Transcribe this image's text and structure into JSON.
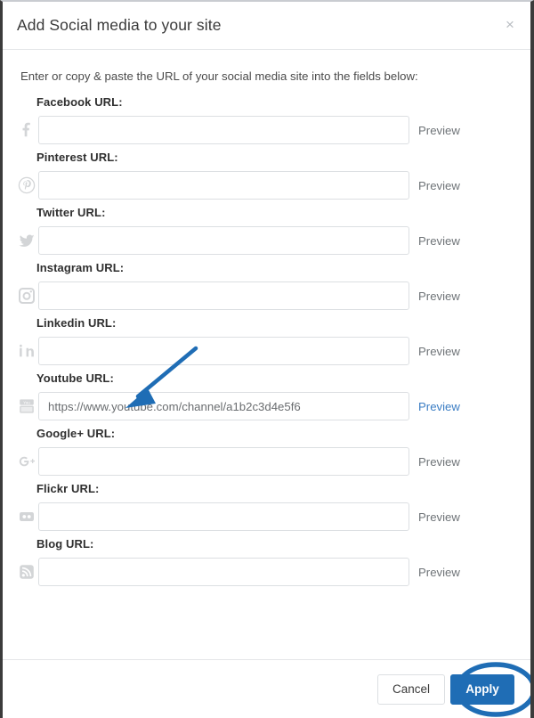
{
  "dialog": {
    "title": "Add Social media to your site",
    "close_label": "×",
    "intro": "Enter or copy & paste the URL of your social media site into the fields below:",
    "preview_label": "Preview",
    "input_placeholder": ""
  },
  "fields": [
    {
      "label": "Facebook URL:",
      "icon": "facebook-icon",
      "value": "",
      "preview": "Preview",
      "preview_active": false
    },
    {
      "label": "Pinterest URL:",
      "icon": "pinterest-icon",
      "value": "",
      "preview": "Preview",
      "preview_active": false
    },
    {
      "label": "Twitter URL:",
      "icon": "twitter-icon",
      "value": "",
      "preview": "Preview",
      "preview_active": false
    },
    {
      "label": "Instagram URL:",
      "icon": "instagram-icon",
      "value": "",
      "preview": "Preview",
      "preview_active": false
    },
    {
      "label": "Linkedin URL:",
      "icon": "linkedin-icon",
      "value": "",
      "preview": "Preview",
      "preview_active": false
    },
    {
      "label": "Youtube URL:",
      "icon": "youtube-icon",
      "value": "https://www.youtube.com/channel/a1b2c3d4e5f6",
      "preview": "Preview",
      "preview_active": true
    },
    {
      "label": "Google+ URL:",
      "icon": "googleplus-icon",
      "value": "",
      "preview": "Preview",
      "preview_active": false
    },
    {
      "label": "Flickr URL:",
      "icon": "flickr-icon",
      "value": "",
      "preview": "Preview",
      "preview_active": false
    },
    {
      "label": "Blog URL:",
      "icon": "rss-icon",
      "value": "",
      "preview": "Preview",
      "preview_active": false
    }
  ],
  "footer": {
    "cancel_label": "Cancel",
    "apply_label": "Apply"
  },
  "annotations": {
    "arrow_color": "#1f6db5",
    "ellipse_color": "#1f6db5",
    "arrow_target": "Youtube URL:",
    "ellipse_target": "Apply"
  },
  "colors": {
    "accent": "#1f6db5",
    "link": "#3b7dc4",
    "icon_gray": "#d3d5d7",
    "border": "#dcdfe2",
    "text": "#2f2f2f"
  }
}
